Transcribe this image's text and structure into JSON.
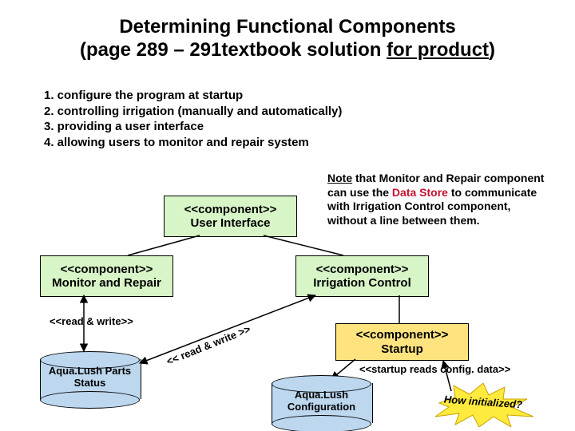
{
  "title_l1": "Determining Functional Components",
  "title_l2a": "(page 289 – 291textbook solution ",
  "title_l2b": "for product",
  "title_l2c": ")",
  "list": {
    "i1": "1. configure the program at startup",
    "i2": "2. controlling irrigation (manually and automatically)",
    "i3": "3. providing a user interface",
    "i4": "4. allowing users to monitor and repair system"
  },
  "comp": {
    "stereo": "<<component>>",
    "ui": "User Interface",
    "monitor": "Monitor and Repair",
    "irrig": "Irrigation Control",
    "startup": "Startup"
  },
  "labels": {
    "rw1": "<<read & write>>",
    "rw2": "<< read & write >>",
    "startup_reads": "<<startup reads config. data>>"
  },
  "note": {
    "pre": "Note",
    "t1": " that Monitor and Repair component can use the ",
    "ds": "Data Store",
    "t2": " to communicate with Irrigation Control component, without a line between them."
  },
  "cylinders": {
    "parts_l1": "Aqua.Lush Parts",
    "parts_l2": "Status",
    "config_l1": "Aqua.Lush",
    "config_l2": "Configuration"
  },
  "star": "How initialized?"
}
